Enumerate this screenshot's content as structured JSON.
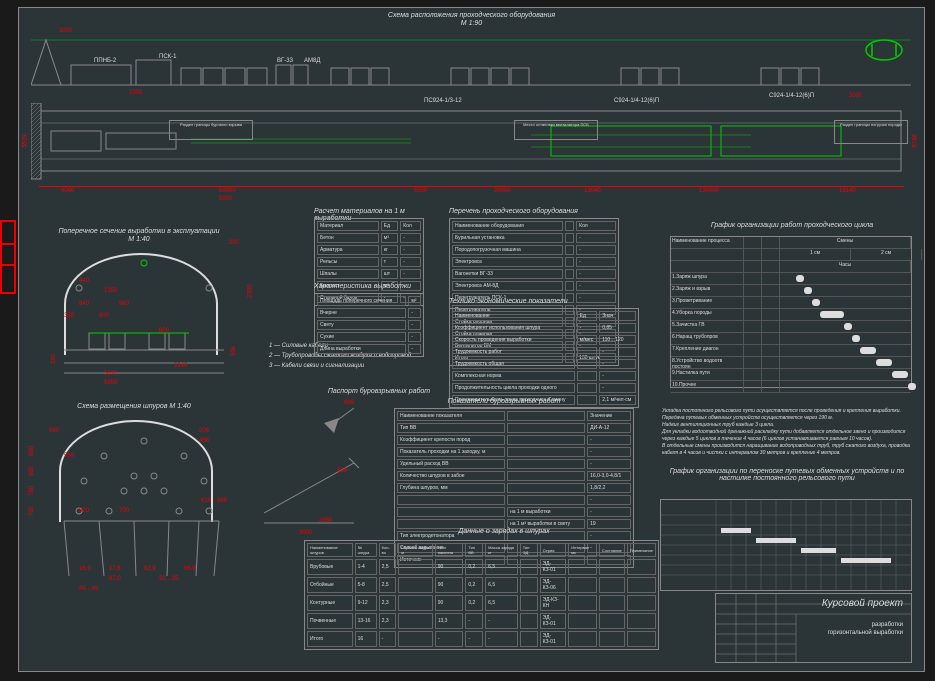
{
  "titles": {
    "main": "Схема расположения проходческого оборудования",
    "main_scale": "М 1:90",
    "cross_section": "Поперечное сечение выработки в эксплуатации",
    "cross_scale": "М 1:40",
    "shpur_scheme": "Схема размещения шпуров М 1:40",
    "passport": "Паспорт буровзрывных работ",
    "calc_table": "Расчет материалов на 1 м выработки",
    "char_table": "Характеристика выработки",
    "equip_table": "Перечень проходческого оборудования",
    "tech_econ": "Технико-экономические показатели",
    "indicators": "Показатели буровзрывных работ",
    "charges": "Данные о зарядах в шпурах",
    "gantt": "График организации работ проходческого цикла",
    "gantt2": "График организации по переноске путевых обменных устройств и по настилке постоянного рельсового пути",
    "titleblock": "Курсовой проект",
    "titleblock_sub1": "разработки",
    "titleblock_sub2": "горизонтальной выработки"
  },
  "labels": {
    "l1": "ППНБ-2",
    "l2": "ПСК-1",
    "l3": "ВГ-33",
    "l4": "АМ8Д",
    "l5": "ПС924-1/3-12",
    "l6": "С924-1/4-12(6)П",
    "l7": "С924-1/4-12(6)П",
    "box1": "Раздел границы бурового взрыва",
    "box2": "Место остановки вентилятора ПСБ",
    "box3": "Раздел границы погрузки породы",
    "legend1": "1 — Силовые кабели",
    "legend2": "2 — Трубопроводы сжатого воздуха и водопровод",
    "legend3": "3 — Кабели связи и сигнализации"
  },
  "dims": {
    "d3000": "3000",
    "d1000": "1000",
    "d5000_a": "5000",
    "d5000_b": "5000",
    "d6000": "6000",
    "d50000": "50000",
    "d5550": "5550",
    "d20000": "20000",
    "d13040": "13040",
    "d130000": "130000",
    "d13140": "13140",
    "d5539": "5539",
    "d5746": "5746",
    "d200": "200",
    "d2300": "2300",
    "d440": "440",
    "d1350": "1350",
    "d840": "840",
    "d960": "960",
    "d350": "350",
    "d900": "900",
    "d600": "600",
    "d180": "180",
    "d506": "506",
    "d5670": "5670",
    "d5950": "5950",
    "d2240": "2240",
    "d560": "560",
    "d550": "550",
    "d206": "206",
    "d456": "456",
    "d820": "820",
    "d700": "700",
    "d619": "619",
    "d869": "869",
    "d886": "886",
    "d3000b": "3000",
    "d689": "689",
    "d2650": "2650",
    "d160": "16,0",
    "d176": "17,6",
    "d929": "92,9",
    "d969": "96,9",
    "d67_0": "67,0",
    "d32_35": "32…35",
    "d4949": "49…49",
    "d700v": "700",
    "d760": "760",
    "d800": "800",
    "d680": "680"
  },
  "char_rows": [
    [
      "Площадь поперечного сечения",
      "м²"
    ],
    [
      "Вчерне",
      "-"
    ],
    [
      "Свету",
      "-"
    ],
    [
      "Сухие",
      "-"
    ],
    [
      "Длина выработки",
      "-"
    ]
  ],
  "calc_rows": [
    [
      "Материал",
      "Ед",
      "Кол"
    ],
    [
      "Бетон",
      "м³",
      "-"
    ],
    [
      "Арматура",
      "кг",
      "-"
    ],
    [
      "Рельсы",
      "т",
      "-"
    ],
    [
      "Шпалы",
      "шт",
      "-"
    ],
    [
      "Балласт",
      "м³",
      "-"
    ],
    [
      "Стальной балок",
      "-",
      "-"
    ]
  ],
  "equip_rows": [
    [
      "Наименование оборудования",
      "",
      "Кол"
    ],
    [
      "Бурильная установка",
      "",
      "-"
    ],
    [
      "Породопогрузочная машина",
      "",
      "-"
    ],
    [
      "Электровоз",
      "",
      "-"
    ],
    [
      "Вагонетки ВГ-33",
      "",
      "-"
    ],
    [
      "Электровоз АМ-8Д",
      "",
      "-"
    ],
    [
      "Перегружатель ПСК-1",
      "",
      "-"
    ],
    [
      "Перегружатель",
      "",
      "-"
    ],
    [
      "Стойка опорная",
      "",
      "-"
    ],
    [
      "Стойка плавная",
      "",
      "-"
    ],
    [
      "Вентилятор ВМ",
      "",
      "-"
    ],
    [
      "Итого",
      "",
      "130 штук"
    ]
  ],
  "tech_rows": [
    [
      "Наименование",
      "Ед",
      "Знач"
    ],
    [
      "Коэффициент использования шпура",
      "-",
      "0,85"
    ],
    [
      "Скорость проведения выработки",
      "м/мес",
      "110…120"
    ],
    [
      "Трудоемкость работ",
      "",
      "-"
    ],
    [
      "Трудоемкость общая",
      "",
      "-"
    ],
    [
      "Комплексная норма",
      "",
      "-"
    ],
    [
      "Продолжительность цикла проходки одного",
      "",
      "-"
    ],
    [
      "Производительность труда проходчика в смену",
      "",
      "2,1 м/чел·см"
    ]
  ],
  "indicator_rows": [
    [
      "Наименование показателя",
      "",
      "Значение"
    ],
    [
      "Тип ВВ",
      "",
      "ДИ-А-12"
    ],
    [
      "Коэффициент крепости пород",
      "",
      "-"
    ],
    [
      "Показатель проходки на 1 заходку, м",
      "",
      "-"
    ],
    [
      "Удельный расход ВВ",
      "",
      "-"
    ],
    [
      "Количество шпуров в забое",
      "",
      "16,0-3,0-4,8/1"
    ],
    [
      "Глубина шпуров, мм",
      "",
      "1,8/2,2"
    ],
    [
      "",
      "",
      "-"
    ],
    [
      "",
      "на 1 м выработки",
      "-"
    ],
    [
      "",
      "на 1 м³ выработки в свету",
      "19"
    ],
    [
      "Тип электродетонатора",
      "",
      "-"
    ],
    [
      "Способ взрывания",
      "",
      "-"
    ],
    [
      "Источник",
      "",
      "-"
    ]
  ],
  "charge_cols": [
    "Наименование шпуров",
    "№ шпура",
    "Кол-во",
    "Глубина шпура м",
    "Угол наклона",
    "Тип ВВ",
    "Масса заряда кг",
    "Тип ЭД",
    "Серия",
    "Интервал мс",
    "Состояние",
    "Примечание"
  ],
  "charge_rows": [
    [
      "Врубовые",
      "1-4",
      "2,5",
      "90",
      "0,2",
      "6,5",
      "ЭД-КЗ-01",
      "-",
      "-",
      "-"
    ],
    [
      "Отбойные",
      "5-8",
      "2,5",
      "90",
      "0,2",
      "6,5",
      "ЭД-КЗ-06",
      "-",
      "-",
      "-"
    ],
    [
      "Контурные",
      "9-12",
      "2,3",
      "90",
      "0,2",
      "6,5",
      "ЭД-КЗ-КН",
      "-",
      "-",
      "-"
    ],
    [
      "Почвенные",
      "13-16",
      "2,3",
      "13,3",
      "-",
      "-",
      "ЭД-КЗ-01",
      "-",
      "-",
      "-"
    ],
    [
      "Итого",
      "16",
      "-",
      "-",
      "-",
      "-",
      "ЭД-КЗ-01",
      "-",
      "-",
      "-"
    ]
  ],
  "gantt_header": {
    "col1": "Наименование процесса",
    "sm": "Смены",
    "h": "Часы",
    "s1": "1 см",
    "s2": "2 см"
  },
  "gantt_rows": [
    {
      "name": "1.Заряж шпура",
      "s": 2,
      "e": 3
    },
    {
      "name": "2.Заряж и взрыв",
      "s": 3,
      "e": 4
    },
    {
      "name": "3.Проветривание",
      "s": 4,
      "e": 5
    },
    {
      "name": "4.Уборка породы",
      "s": 5,
      "e": 8
    },
    {
      "name": "5.Зачистка ГВ",
      "s": 8,
      "e": 9
    },
    {
      "name": "6.Наращ трубопров",
      "s": 9,
      "e": 10
    },
    {
      "name": "7.Крепление диагон",
      "s": 10,
      "e": 12
    },
    {
      "name": "8.Устройство водоотв постоян",
      "s": 12,
      "e": 14
    },
    {
      "name": "9.Настилка пути",
      "s": 14,
      "e": 16
    },
    {
      "name": "10.Прочее",
      "s": 16,
      "e": 17
    }
  ],
  "notes_text": [
    "Укладка постоянного рельсового пути осуществляется после проведения и крепления выработки.",
    "Передача путевых обменных устройств осуществляется через 190 м.",
    "Надвиг вентиляционных труб каждые 3 цикла.",
    "Для укладки водоотводной дренажной раскладку пути добавляется отдельное звено и производится через каждые 5 циклов в течение 4 часов (6 циклов устанавливается равным 10 часов).",
    "В отдельные смены производится наращивание водопроводных труб, труб сжатого воздуха, проводка кабеля в 4 часов и чистки с интервалом 30 метров и крепление 4 метров."
  ]
}
